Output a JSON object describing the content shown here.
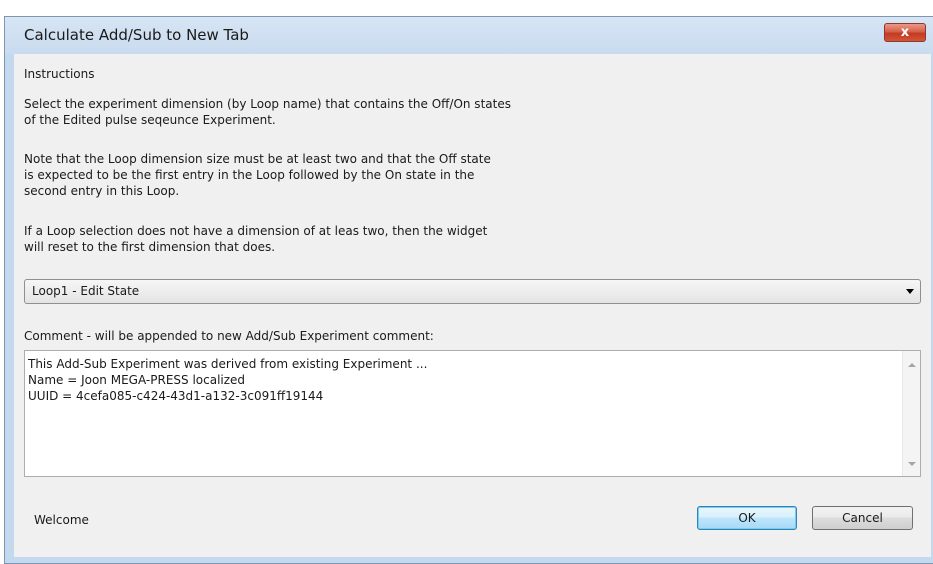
{
  "dialog": {
    "title": "Calculate Add/Sub to New Tab",
    "close_label": "x"
  },
  "instructions": {
    "heading": "Instructions",
    "para1_line1": "Select the experiment dimension (by Loop name) that contains the Off/On states",
    "para1_line2": "of the Edited pulse seqeunce Experiment.",
    "para2_line1": "Note that the Loop dimension size must be at least two and that the Off state",
    "para2_line2": "is expected to be the first entry in the Loop followed by the On state in the",
    "para2_line3": "second entry in this Loop.",
    "para3_line1": "If a Loop selection does not have a dimension of at leas two, then the widget",
    "para3_line2": "will reset to the first dimension that does."
  },
  "loop_select": {
    "selected": "Loop1 - Edit State"
  },
  "comment": {
    "label": "Comment - will be appended to new Add/Sub Experiment comment:",
    "lines": [
      "This Add-Sub Experiment was derived from existing Experiment ...",
      "Name = Joon MEGA-PRESS localized",
      "UUID = 4cefa085-c424-43d1-a132-3c091ff19144"
    ]
  },
  "status": {
    "text": "Welcome"
  },
  "buttons": {
    "ok": "OK",
    "cancel": "Cancel"
  },
  "colors": {
    "frame": "#c5d9ee",
    "client": "#f0f0f0",
    "close_button": "#c9452c",
    "ok_border": "#3c7fb1"
  }
}
